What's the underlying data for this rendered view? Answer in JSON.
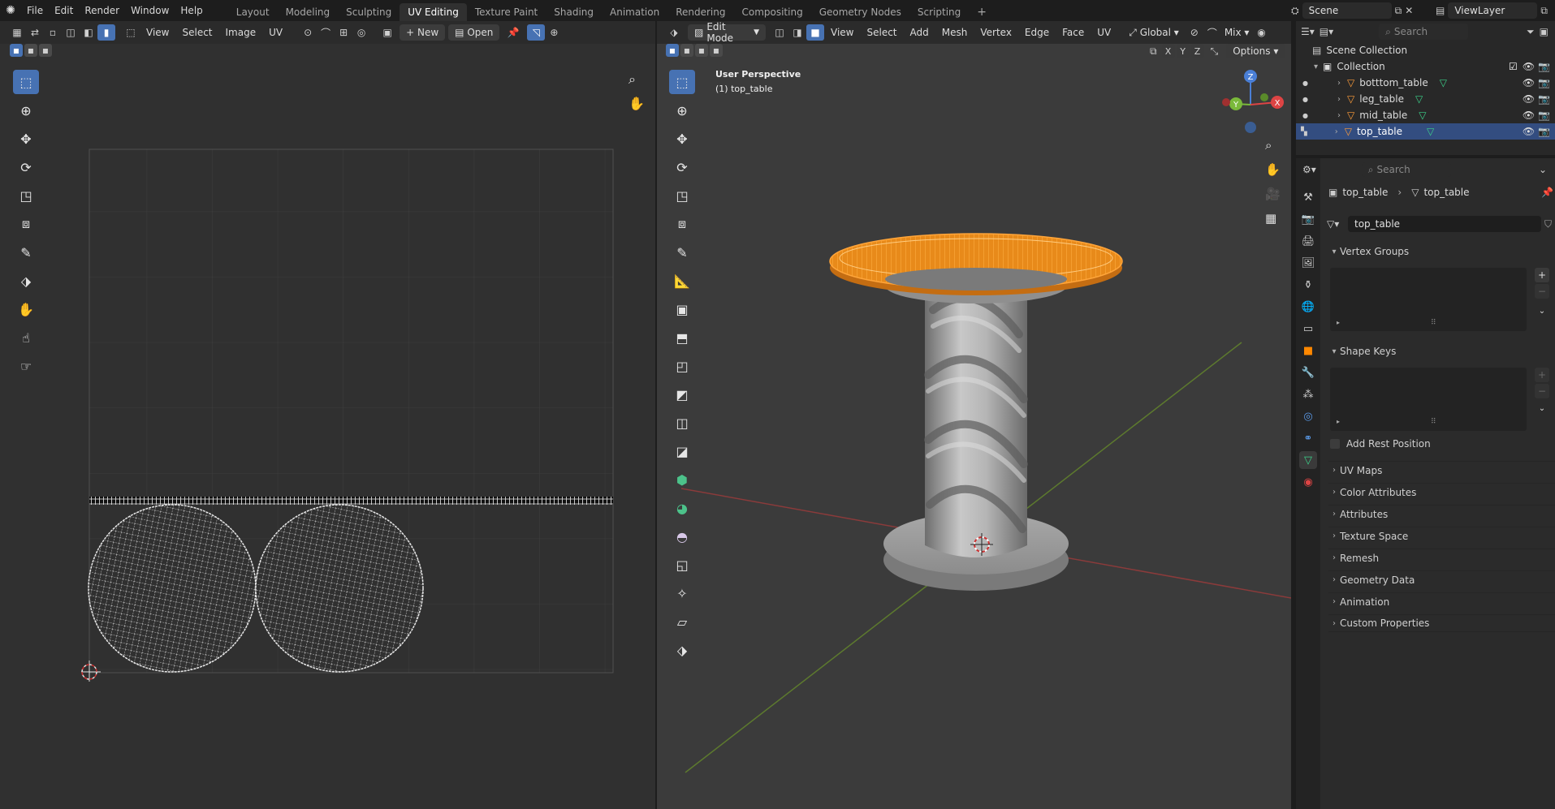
{
  "app": {
    "menus": [
      "File",
      "Edit",
      "Render",
      "Window",
      "Help"
    ],
    "workspaces": [
      "Layout",
      "Modeling",
      "Sculpting",
      "UV Editing",
      "Texture Paint",
      "Shading",
      "Animation",
      "Rendering",
      "Compositing",
      "Geometry Nodes",
      "Scripting"
    ],
    "active_workspace": "UV Editing",
    "scene_name": "Scene",
    "view_layer": "ViewLayer"
  },
  "uv_editor": {
    "menus": [
      "View",
      "Select",
      "Image",
      "UV"
    ],
    "new_label": "New",
    "open_label": "Open"
  },
  "viewport": {
    "mode": "Edit Mode",
    "menus": [
      "View",
      "Select",
      "Add",
      "Mesh",
      "Vertex",
      "Edge",
      "Face",
      "UV"
    ],
    "transform_orientation": "Global",
    "proportional": "Mix",
    "axes": [
      "X",
      "Y",
      "Z"
    ],
    "options_label": "Options",
    "overlay_line1": "User Perspective",
    "overlay_line2": "(1) top_table",
    "gizmo": {
      "x": "X",
      "y": "Y",
      "z": "Z"
    }
  },
  "outliner": {
    "search_placeholder": "Search",
    "root": "Scene Collection",
    "collection": "Collection",
    "items": [
      {
        "name": "botttom_table",
        "selected": false
      },
      {
        "name": "leg_table",
        "selected": false
      },
      {
        "name": "mid_table",
        "selected": false
      },
      {
        "name": "top_table",
        "selected": true
      }
    ]
  },
  "properties": {
    "search_placeholder": "Search",
    "breadcrumb_object": "top_table",
    "breadcrumb_data": "top_table",
    "data_name": "top_table",
    "vertex_groups_label": "Vertex Groups",
    "shape_keys_label": "Shape Keys",
    "add_rest_position_label": "Add Rest Position",
    "sections": [
      "UV Maps",
      "Color Attributes",
      "Attributes",
      "Texture Space",
      "Remesh",
      "Geometry Data",
      "Animation",
      "Custom Properties"
    ]
  },
  "colors": {
    "accent": "#4772b3",
    "selection_orange": "#ff8c00",
    "background": "#1d1d1d",
    "editor": "#303030"
  }
}
